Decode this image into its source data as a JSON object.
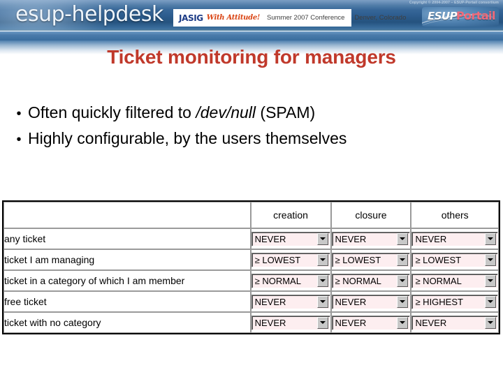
{
  "banner": {
    "brand": "esup-helpdesk",
    "conference": {
      "org": "JASIG",
      "tagline": "With Attitude!",
      "event": "Summer 2007 Conference",
      "location": "Denver, Colorado"
    },
    "copyright": "Copyright © 2004-2007 – ESUP-Portail consortium",
    "logo": {
      "part1": "ESUP",
      "part2": "Portail"
    },
    "colors": {
      "banner_blue": "#2e5e90",
      "title_red": "#c0392b",
      "select_pink": "#fdeef0"
    }
  },
  "slide": {
    "title": "Ticket monitoring for managers",
    "bullets": [
      {
        "marker": "•",
        "pre": "Often quickly filtered to ",
        "italic": "/dev/null",
        "post": " (SPAM)"
      },
      {
        "marker": "•",
        "pre": "Highly configurable, by the users themselves",
        "italic": "",
        "post": ""
      }
    ]
  },
  "table": {
    "corner_header": "",
    "columns": [
      "creation",
      "closure",
      "others"
    ],
    "rows": [
      {
        "label": "any ticket",
        "values": [
          "NEVER",
          "NEVER",
          "NEVER"
        ]
      },
      {
        "label": "ticket I am managing",
        "values": [
          "≥ LOWEST",
          "≥ LOWEST",
          "≥ LOWEST"
        ]
      },
      {
        "label": "ticket in a category of which I am member",
        "values": [
          "≥ NORMAL",
          "≥ NORMAL",
          "≥ NORMAL"
        ]
      },
      {
        "label": "free ticket",
        "values": [
          "NEVER",
          "NEVER",
          "≥ HIGHEST"
        ]
      },
      {
        "label": "ticket with no category",
        "values": [
          "NEVER",
          "NEVER",
          "NEVER"
        ]
      }
    ],
    "select_options": [
      "NEVER",
      "≥ LOWEST",
      "≥ NORMAL",
      "≥ HIGHEST"
    ]
  }
}
